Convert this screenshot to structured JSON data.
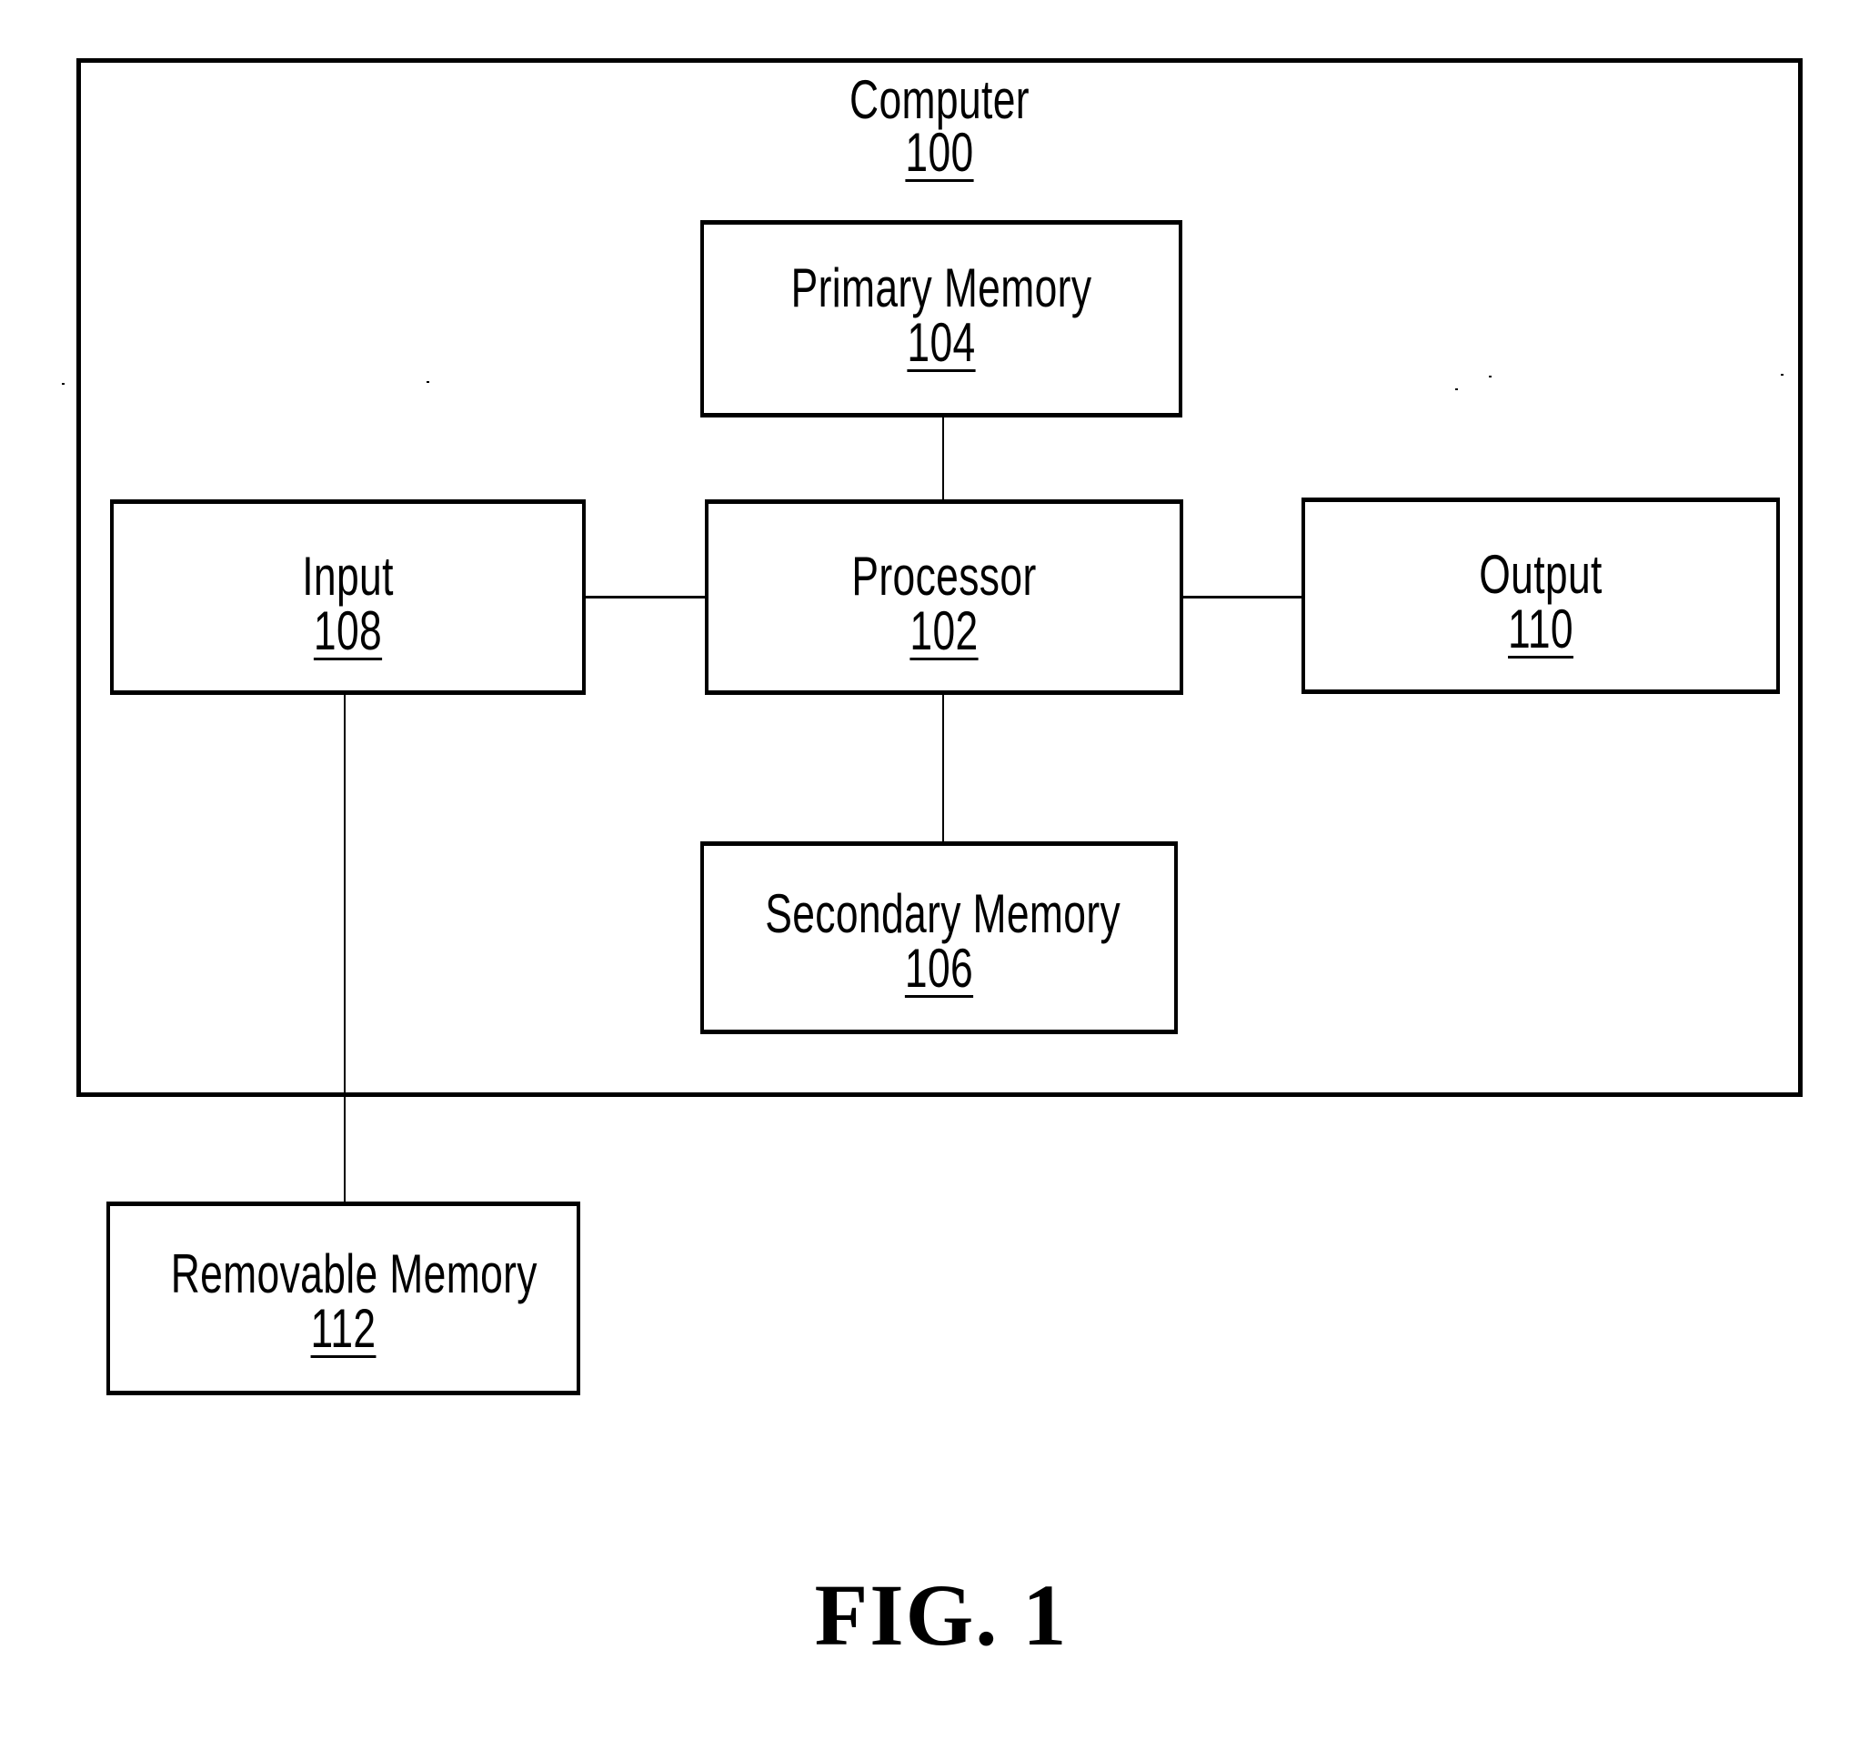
{
  "diagram": {
    "container": {
      "name": "Computer",
      "ref": "100"
    },
    "nodes": [
      {
        "id": "primary-memory",
        "name": "Primary Memory",
        "ref": "104"
      },
      {
        "id": "input",
        "name": "Input",
        "ref": "108"
      },
      {
        "id": "processor",
        "name": "Processor",
        "ref": "102"
      },
      {
        "id": "output",
        "name": "Output",
        "ref": "110"
      },
      {
        "id": "secondary-memory",
        "name": "Secondary Memory",
        "ref": "106"
      },
      {
        "id": "removable-memory",
        "name": "Removable Memory",
        "ref": "112"
      }
    ],
    "edges": [
      {
        "from": "primary-memory",
        "to": "processor"
      },
      {
        "from": "input",
        "to": "processor"
      },
      {
        "from": "processor",
        "to": "output"
      },
      {
        "from": "processor",
        "to": "secondary-memory"
      },
      {
        "from": "input",
        "to": "removable-memory"
      }
    ]
  },
  "caption": "FIG. 1"
}
